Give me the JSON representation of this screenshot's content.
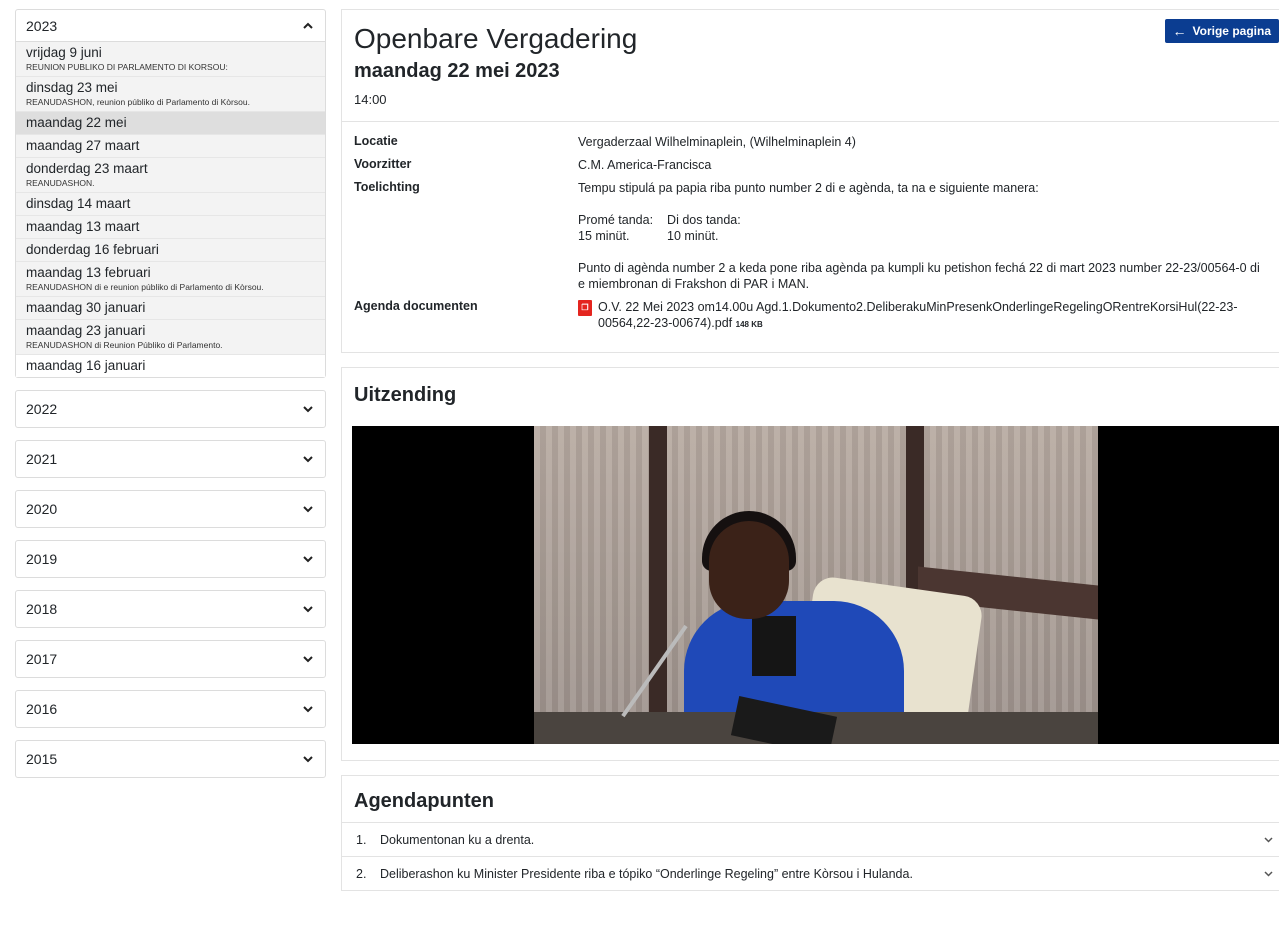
{
  "sidebar": {
    "open_year": "2023",
    "meetings": [
      {
        "date": "vrijdag 9 juni",
        "sub": "REUNION PUBLIKO DI PARLAMENTO DI KORSOU:"
      },
      {
        "date": "dinsdag 23 mei",
        "sub": "REANUDASHON, reunion públiko di Parlamento di Kòrsou."
      },
      {
        "date": "maandag 22 mei",
        "sub": ""
      },
      {
        "date": "maandag 27 maart",
        "sub": ""
      },
      {
        "date": "donderdag 23 maart",
        "sub": "REANUDASHON."
      },
      {
        "date": "dinsdag 14 maart",
        "sub": ""
      },
      {
        "date": "maandag 13 maart",
        "sub": ""
      },
      {
        "date": "donderdag 16 februari",
        "sub": ""
      },
      {
        "date": "maandag 13 februari",
        "sub": "REANUDASHON di e reunion públiko di Parlamento di Kòrsou."
      },
      {
        "date": "maandag 30 januari",
        "sub": ""
      },
      {
        "date": "maandag 23 januari",
        "sub": "REANUDASHON di Reunion Públiko di Parlamento."
      },
      {
        "date": "maandag 16 januari",
        "sub": ""
      }
    ],
    "collapsed_years": [
      "2022",
      "2021",
      "2020",
      "2019",
      "2018",
      "2017",
      "2016",
      "2015"
    ]
  },
  "header": {
    "title": "Openbare Vergadering",
    "date": "maandag 22 mei 2023",
    "time": "14:00",
    "back_label": "Vorige pagina"
  },
  "details": {
    "locatie_label": "Locatie",
    "locatie": "Vergaderzaal Wilhelminaplein, (Wilhelminaplein 4)",
    "voorzitter_label": "Voorzitter",
    "voorzitter": "C.M. America-Francisca",
    "toelichting_label": "Toelichting",
    "toelichting_1": "Tempu stipulá pa papia riba punto number 2 di e agènda, ta na e siguiente manera:",
    "tanda_1_label": "Promé tanda:",
    "tanda_1_value": "15 minüt.",
    "tanda_2_label": "Di dos tanda:",
    "tanda_2_value": "10 minüt.",
    "toelichting_2": "Punto di agènda number 2 a keda pone riba agènda pa kumpli ku petishon fechá 22 di mart 2023 number 22-23/00564-0 di e miembronan di Frakshon di PAR i MAN.",
    "docs_label": "Agenda documenten",
    "doc_name": "O.V. 22 Mei 2023 om14.00u Agd.1.Dokumento2.DeliberakuMinPresenkOnderlingeRegelingORentreKorsiHul(22-23-00564,22-23-00674).pdf",
    "doc_size": "148 KB"
  },
  "uitzending": {
    "title": "Uitzending"
  },
  "agenda": {
    "title": "Agendapunten",
    "items": [
      {
        "num": "1.",
        "text": "Dokumentonan ku a drenta."
      },
      {
        "num": "2.",
        "text": "Deliberashon ku Minister Presidente riba e tópiko “Onderlinge Regeling” entre Kòrsou i Hulanda."
      }
    ]
  }
}
